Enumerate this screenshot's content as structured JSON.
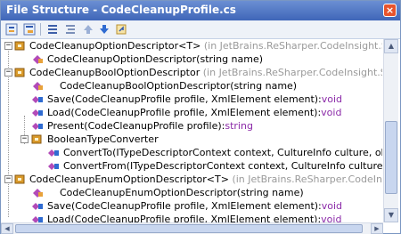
{
  "window": {
    "title": "File Structure - CodeCleanupProfile.cs",
    "close_glyph": "×"
  },
  "toolbar": {
    "buttons": [
      "expand-all",
      "collapse-all",
      "sort-alpha",
      "sort-group",
      "move-up",
      "move-down",
      "goto"
    ]
  },
  "tree": {
    "rows": [
      {
        "text": "CodeCleanupOptionDescriptor<T>",
        "ns": " (in JetBrains.ReSharper.CodeInsight.Services.CodeClean",
        "type": ""
      },
      {
        "text": "CodeCleanupOptionDescriptor(string name)",
        "ns": "",
        "type": ""
      },
      {
        "text": "CodeCleanupBoolOptionDescriptor",
        "ns": " (in JetBrains.ReSharper.CodeInsight.Services.CodeCle",
        "type": ""
      },
      {
        "text": "CodeCleanupBoolOptionDescriptor(string name)",
        "ns": "",
        "type": ""
      },
      {
        "text": "Save(CodeCleanupProfile profile, XmlElement element):",
        "ns": "",
        "type": "void"
      },
      {
        "text": "Load(CodeCleanupProfile profile, XmlElement element):",
        "ns": "",
        "type": "void"
      },
      {
        "text": "Present(CodeCleanupProfile profile):",
        "ns": "",
        "type": "string"
      },
      {
        "text": "BooleanTypeConverter",
        "ns": "",
        "type": ""
      },
      {
        "text": "ConvertTo(ITypeDescriptorContext context, CultureInfo culture, object value, Ty",
        "ns": "",
        "type": ""
      },
      {
        "text": "ConvertFrom(ITypeDescriptorContext context, CultureInfo culture, object value)",
        "ns": "",
        "type": ""
      },
      {
        "text": "CodeCleanupEnumOptionDescriptor<T>",
        "ns": " (in JetBrains.ReSharper.CodeInsight.Services.Code",
        "type": ""
      },
      {
        "text": "CodeCleanupEnumOptionDescriptor(string name)",
        "ns": "",
        "type": ""
      },
      {
        "text": "Save(CodeCleanupProfile profile, XmlElement element):",
        "ns": "",
        "type": "void"
      },
      {
        "text": "Load(CodeCleanupProfile profile, XmlElement element):",
        "ns": "",
        "type": "void"
      }
    ]
  },
  "colors": {
    "title_bar": "#3f66b8",
    "namespace_text": "#9a9a9a",
    "return_type": "#8b2aa8",
    "class_icon": "#d99a2b",
    "method_icon": "#b24bb8"
  }
}
